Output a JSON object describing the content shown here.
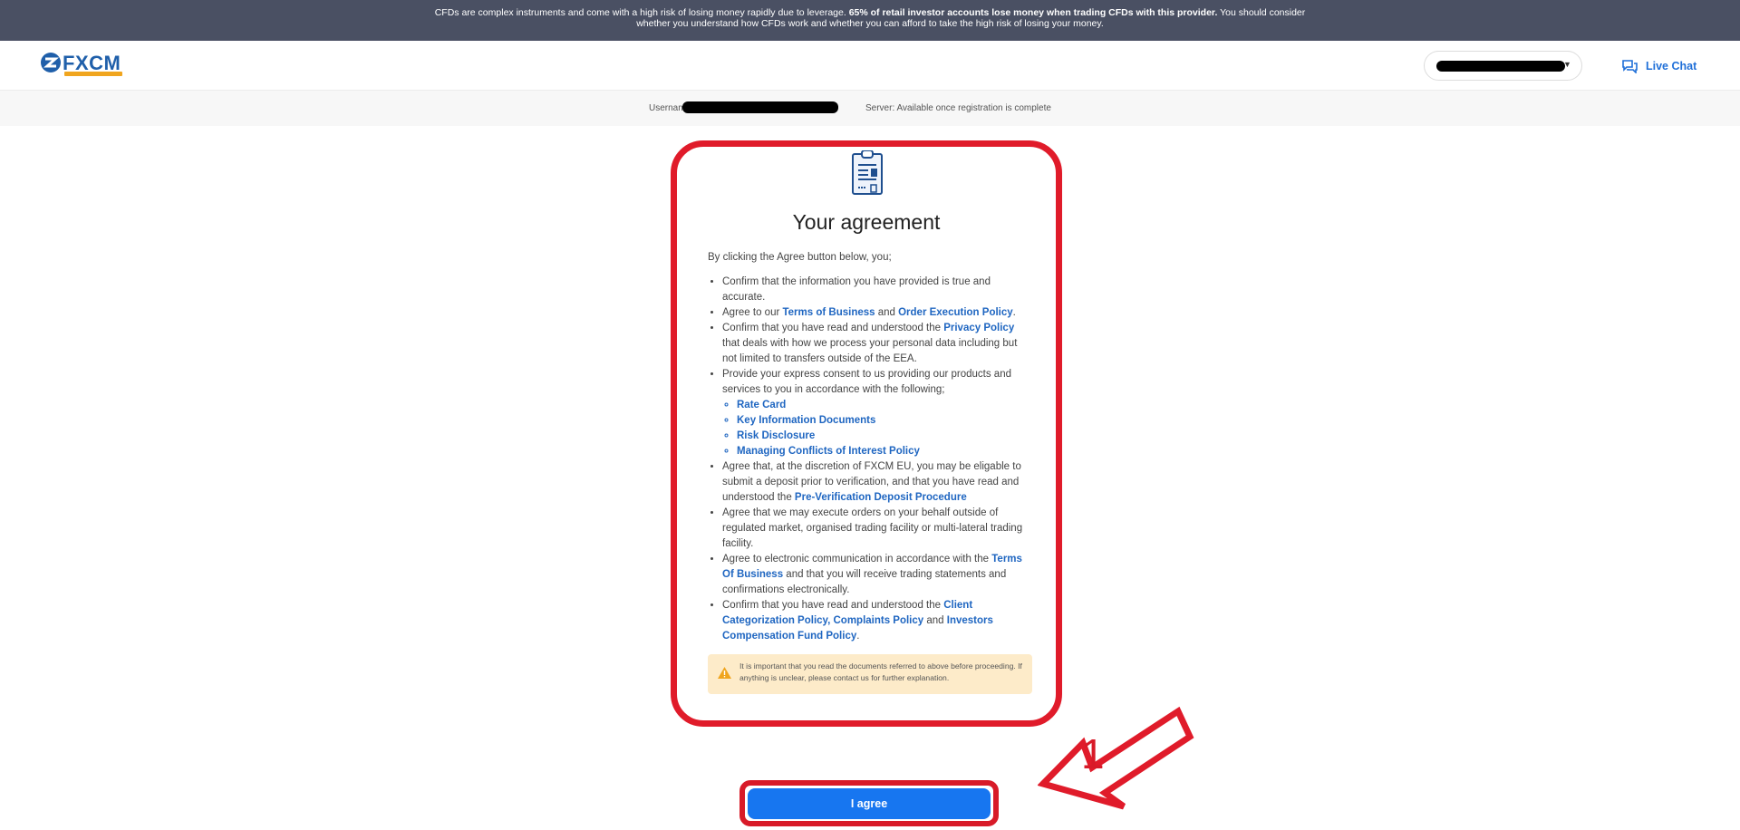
{
  "risk_banner": {
    "text_before": "CFDs are complex instruments and come with a high risk of losing money rapidly due to leverage. ",
    "text_bold": "65% of retail investor accounts lose money when trading CFDs with this provider.",
    "text_after": " You should consider",
    "line2": "whether you understand how CFDs work and whether you can afford to take the high risk of losing your money."
  },
  "header": {
    "logo_text": "FXCM",
    "live_chat_label": "Live Chat"
  },
  "info_bar": {
    "username_label": "Usernam",
    "server_text": "Server: Available once registration is complete"
  },
  "card": {
    "title": "Your agreement",
    "intro": "By clicking the Agree button below, you;",
    "b1": "Confirm that the information you have provided is true and accurate.",
    "b2_pre": "Agree to our ",
    "b2_link1": "Terms of Business",
    "b2_mid": " and ",
    "b2_link2": "Order Execution Policy",
    "b2_post": ".",
    "b3_pre": "Confirm that you have read and understood the ",
    "b3_link": "Privacy Policy",
    "b3_post": " that deals with how we process your personal data including but not limited to transfers outside of the EEA.",
    "b4": "Provide your express consent to us providing our products and services to you in accordance with the following;",
    "sub_links": [
      "Rate Card",
      "Key Information Documents",
      "Risk Disclosure",
      "Managing Conflicts of Interest Policy"
    ],
    "b5_pre": "Agree that, at the discretion of FXCM EU, you may be eligable to submit a deposit prior to verification, and that you have read and understood the ",
    "b5_link": "Pre-Verification Deposit Procedure",
    "b6": "Agree that we may execute orders on your behalf outside of regulated market, organised trading facility or multi-lateral trading facility.",
    "b7_pre": "Agree to electronic communication in accordance with the ",
    "b7_link": "Terms Of Business",
    "b7_post": " and that you will receive trading statements and confirmations electronically.",
    "b8_pre": "Confirm that you have read and understood the ",
    "b8_link1": "Client Categorization Policy",
    "b8_sep": ", ",
    "b8_link2": "Complaints Policy",
    "b8_mid": " and ",
    "b8_link3": "Investors Compensation Fund Policy",
    "b8_post": ".",
    "warning": "It is important that you read the documents referred to above before proceeding. If anything is unclear, please contact us for further explanation."
  },
  "agree_button_label": "I agree",
  "annotation_number": "1",
  "colors": {
    "banner": "#4a5063",
    "link": "#1f66c1",
    "button": "#1776f0",
    "highlight": "#e01b2a",
    "warning_bg": "#fdebc9"
  }
}
